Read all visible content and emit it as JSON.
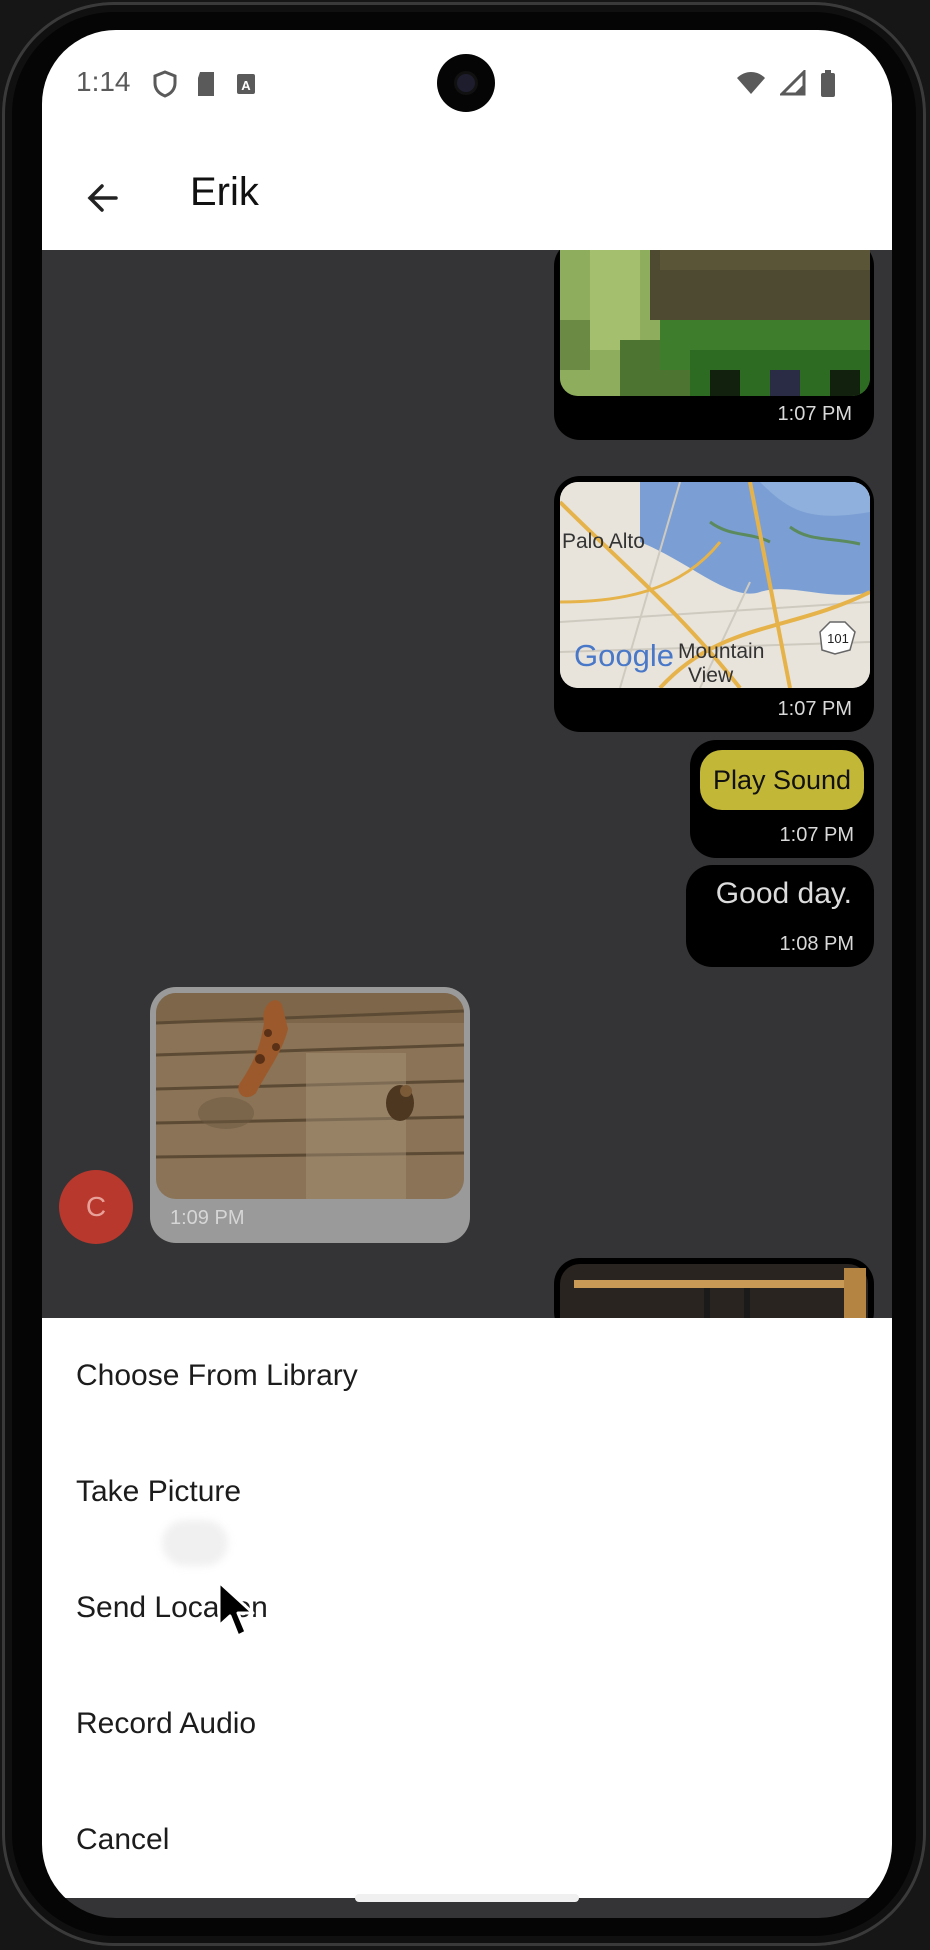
{
  "status_bar": {
    "time": "1:14",
    "left_icons": [
      "shield-icon",
      "sd-card-icon",
      "a-badge-icon"
    ],
    "right_icons": [
      "wifi-icon",
      "signal-icon",
      "battery-icon"
    ]
  },
  "app_bar": {
    "back_icon": "arrow-left-icon",
    "title": "Erik"
  },
  "messages": [
    {
      "type": "image",
      "side": "outgoing",
      "time": "1:07 PM"
    },
    {
      "type": "map",
      "side": "outgoing",
      "time": "1:07 PM",
      "map_labels": {
        "city1": "Palo Alto",
        "city2_line1": "Mountain",
        "city2_line2": "View",
        "shield": "101",
        "logo": "Google"
      }
    },
    {
      "type": "audio",
      "side": "outgoing",
      "button_label": "Play Sound",
      "time": "1:07 PM"
    },
    {
      "type": "text",
      "side": "outgoing",
      "text": "Good day.",
      "time": "1:08 PM"
    },
    {
      "type": "image",
      "side": "incoming",
      "time": "1:09 PM",
      "avatar_initial": "C"
    }
  ],
  "action_sheet": {
    "items": [
      "Choose From Library",
      "Take Picture",
      "Send Location",
      "Record Audio",
      "Cancel"
    ]
  },
  "colors": {
    "chat_background": "#343436",
    "outgoing_bubble": "#000000",
    "incoming_bubble": "#9a9a9a",
    "play_button": "#c2b737",
    "avatar": "#b8382d"
  }
}
